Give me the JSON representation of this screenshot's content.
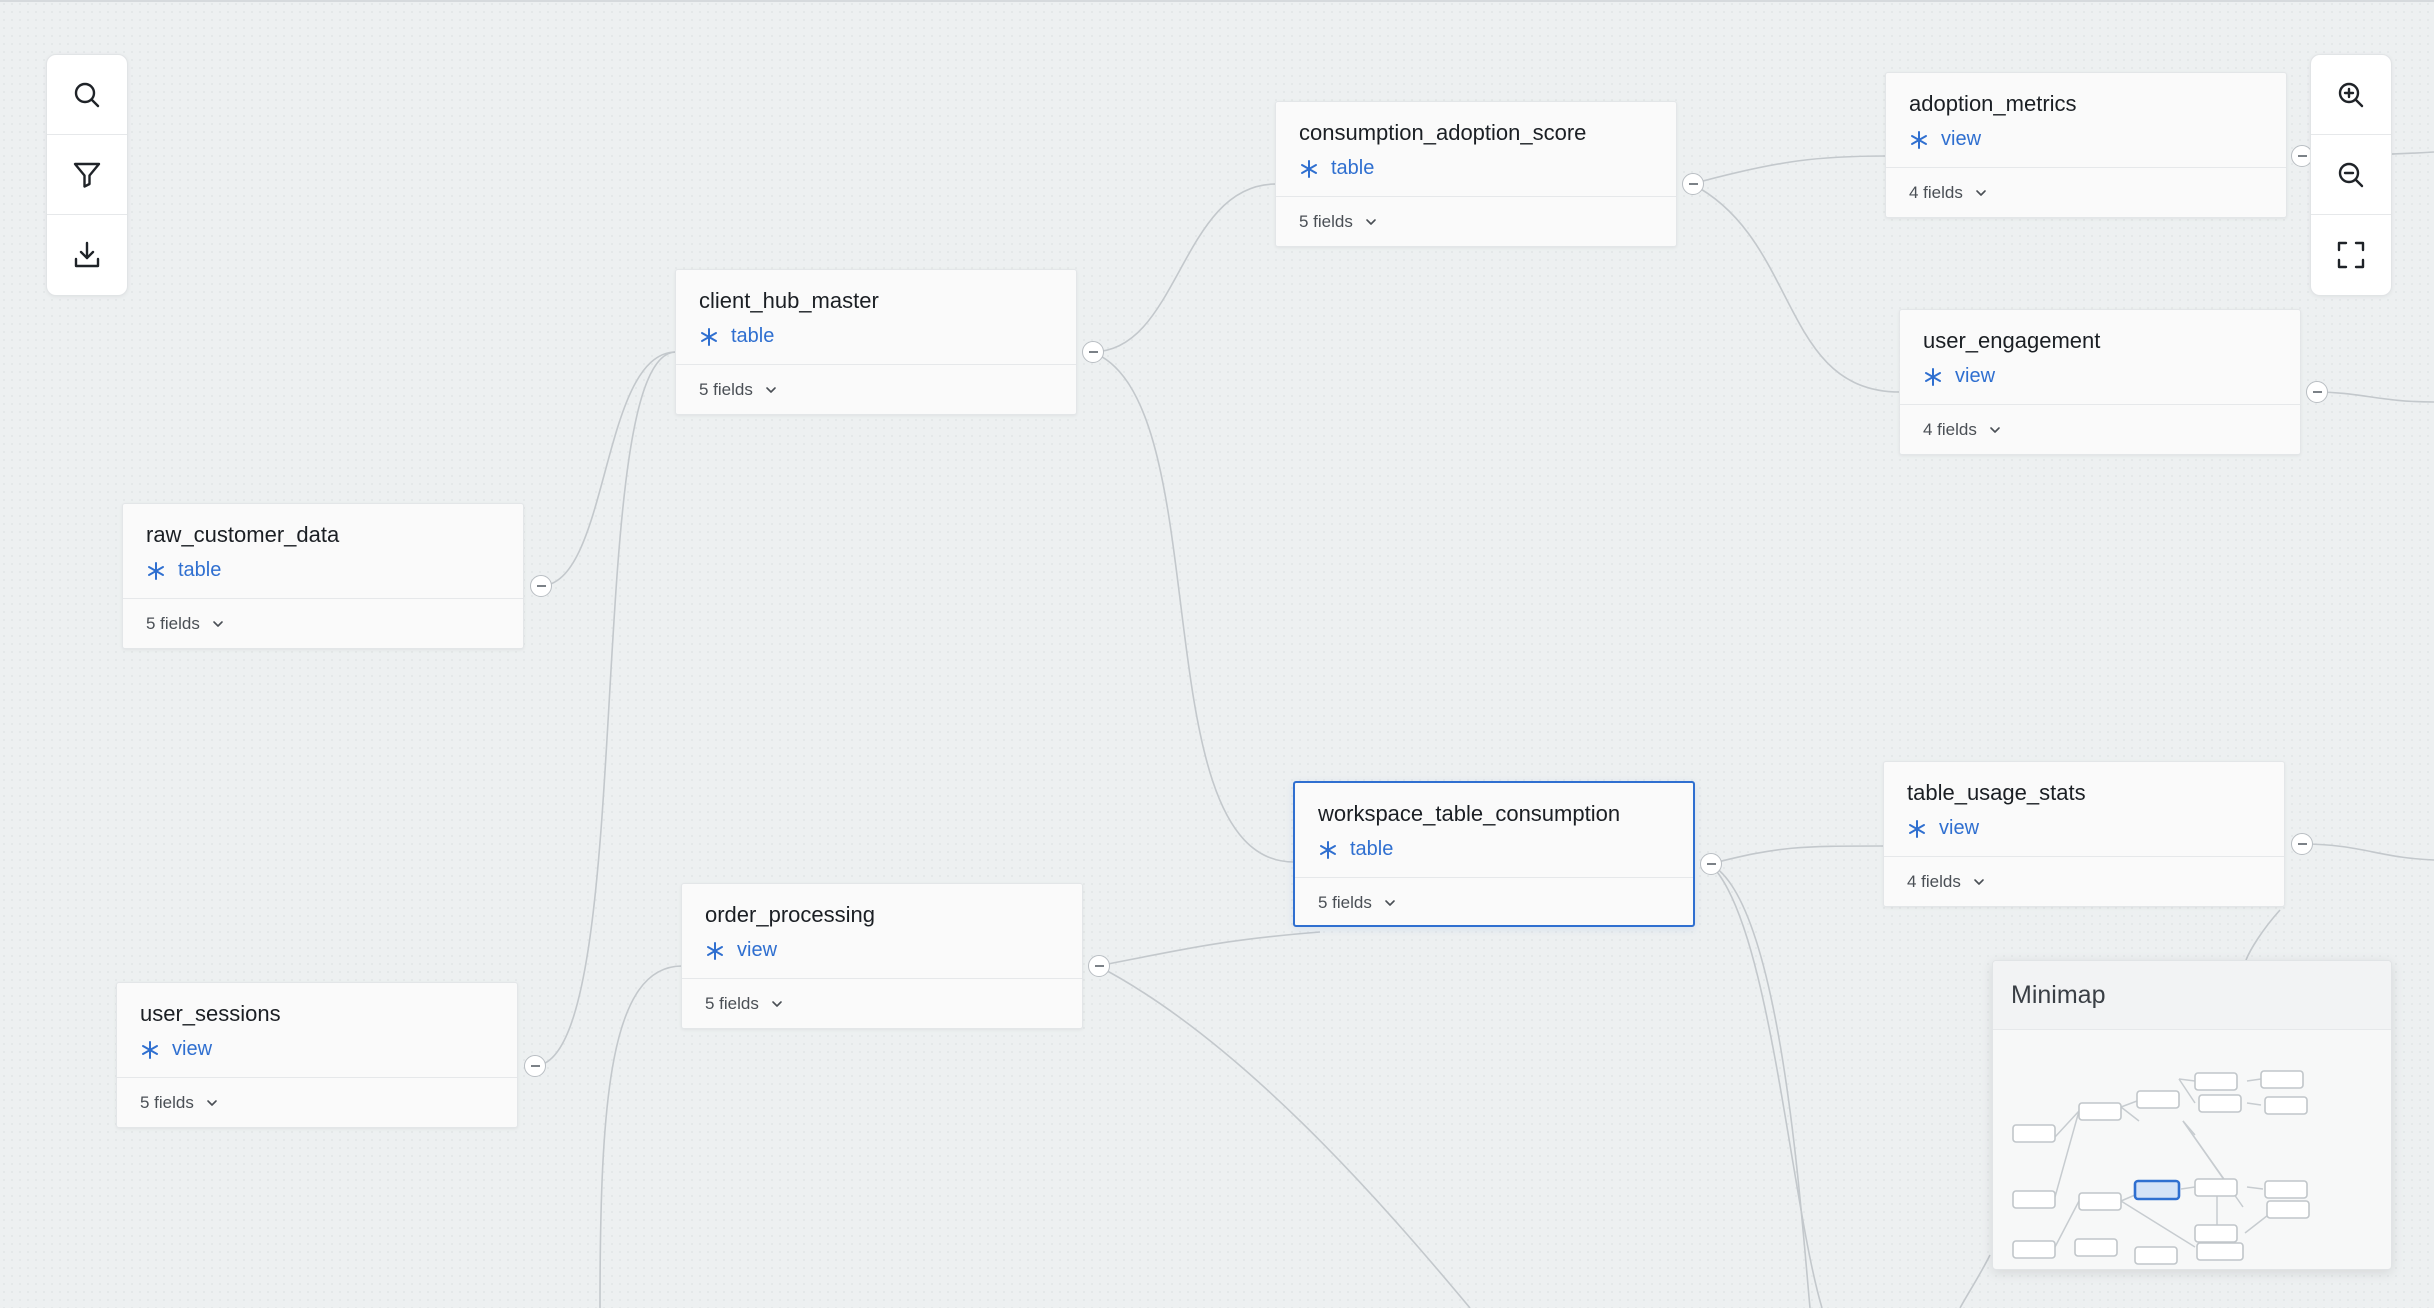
{
  "toolbar_left": {
    "buttons": [
      {
        "name": "search-button",
        "icon": "search-icon"
      },
      {
        "name": "filter-button",
        "icon": "filter-icon"
      },
      {
        "name": "download-button",
        "icon": "download-icon"
      }
    ]
  },
  "toolbar_right": {
    "buttons": [
      {
        "name": "zoom-in-button",
        "icon": "zoom-in-icon"
      },
      {
        "name": "zoom-out-button",
        "icon": "zoom-out-icon"
      },
      {
        "name": "fit-view-button",
        "icon": "fullscreen-icon"
      }
    ]
  },
  "nodes": {
    "raw_customer_data": {
      "title": "raw_customer_data",
      "type": "table",
      "fields": "5 fields"
    },
    "user_sessions": {
      "title": "user_sessions",
      "type": "view",
      "fields": "5 fields"
    },
    "client_hub_master": {
      "title": "client_hub_master",
      "type": "table",
      "fields": "5 fields"
    },
    "order_processing": {
      "title": "order_processing",
      "type": "view",
      "fields": "5 fields"
    },
    "consumption_adoption_score": {
      "title": "consumption_adoption_score",
      "type": "table",
      "fields": "5 fields"
    },
    "workspace_table_consumption": {
      "title": "workspace_table_consumption",
      "type": "table",
      "fields": "5 fields"
    },
    "adoption_metrics": {
      "title": "adoption_metrics",
      "type": "view",
      "fields": "4 fields"
    },
    "user_engagement": {
      "title": "user_engagement",
      "type": "view",
      "fields": "4 fields"
    },
    "table_usage_stats": {
      "title": "table_usage_stats",
      "type": "view",
      "fields": "4 fields"
    }
  },
  "selected_node": "workspace_table_consumption",
  "minimap": {
    "title": "Minimap"
  },
  "colors": {
    "accent": "#2f6fd0",
    "canvas": "#edf0f1",
    "edge": "#c3c8cc"
  }
}
